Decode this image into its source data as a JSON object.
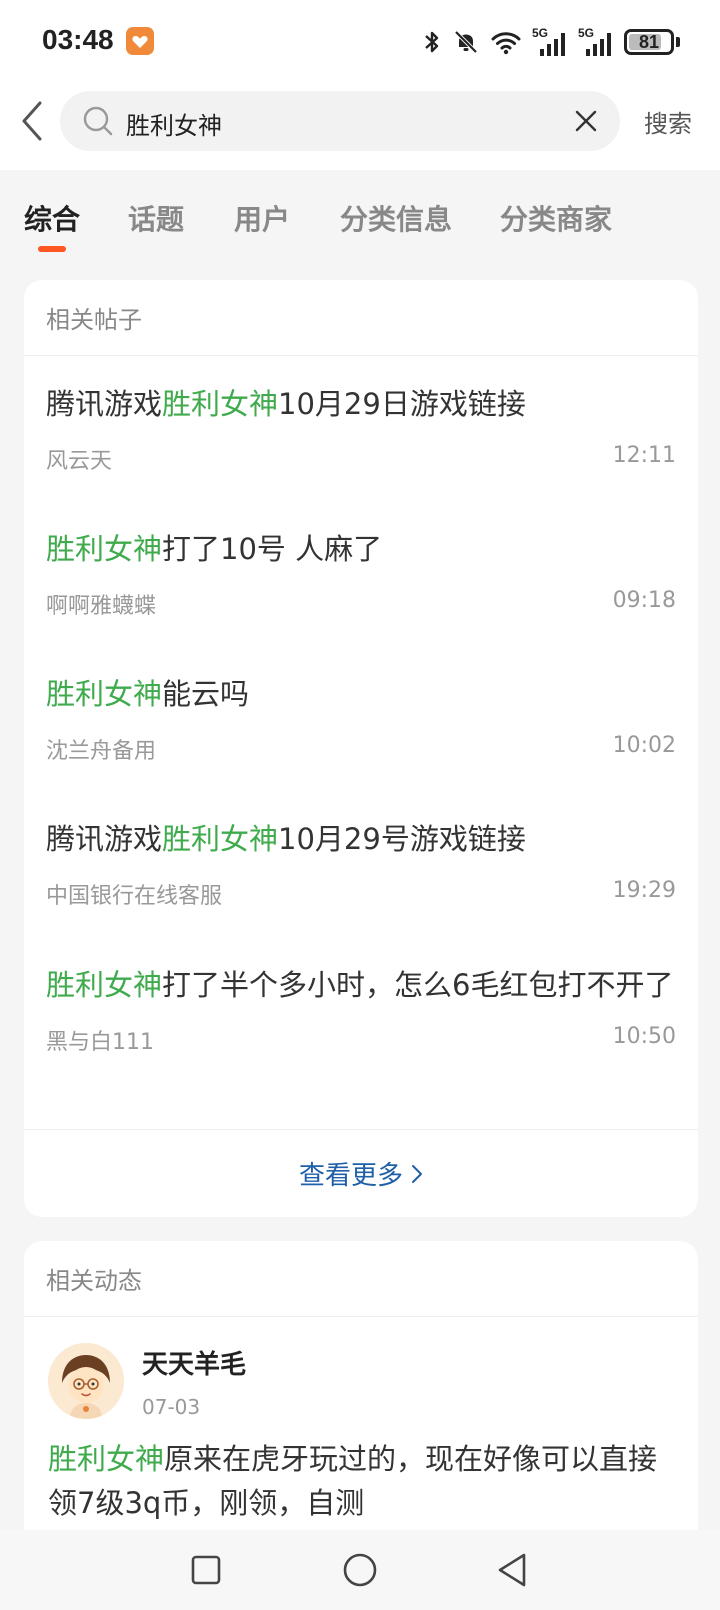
{
  "status_bar": {
    "time": "03:48",
    "network_1": "5G",
    "network_2": "5G",
    "battery": "81",
    "battery_level": 0.81
  },
  "search": {
    "query": "胜利女神",
    "search_label": "搜索"
  },
  "tabs": [
    {
      "label": "综合",
      "active": true
    },
    {
      "label": "话题",
      "active": false
    },
    {
      "label": "用户",
      "active": false
    },
    {
      "label": "分类信息",
      "active": false
    },
    {
      "label": "分类商家",
      "active": false
    }
  ],
  "related_posts": {
    "header": "相关帖子",
    "items": [
      {
        "title_before": "腾讯游戏",
        "title_highlight": "胜利女神",
        "title_after": "10月29日游戏链接",
        "author": "风云天",
        "time": "12:11"
      },
      {
        "title_before": "",
        "title_highlight": "胜利女神",
        "title_after": "打了10号 人麻了",
        "author": "啊啊雅蠛蝶",
        "time": "09:18"
      },
      {
        "title_before": "",
        "title_highlight": "胜利女神",
        "title_after": "能云吗",
        "author": "沈兰舟备用",
        "time": "10:02"
      },
      {
        "title_before": "腾讯游戏",
        "title_highlight": "胜利女神",
        "title_after": "10月29号游戏链接",
        "author": "中国银行在线客服",
        "time": "19:29"
      },
      {
        "title_before": "",
        "title_highlight": "胜利女神",
        "title_after": "打了半个多小时，怎么6毛红包打不开了",
        "author": "黑与白111",
        "time": "10:50"
      }
    ],
    "see_more": "查看更多"
  },
  "related_feeds": {
    "header": "相关动态",
    "user_name": "天天羊毛",
    "date": "07-03",
    "text_highlight": "胜利女神",
    "text_after": "原来在虎牙玩过的，现在好像可以直接领7级3q币，刚领，自测"
  },
  "colors": {
    "highlight": "#3fab4c",
    "tab_indicator": "#ff5722",
    "link": "#1f5fa8",
    "app_badge": "#f08a3a"
  },
  "icons": {
    "back": "back-arrow-icon",
    "search": "magnifier-icon",
    "clear": "close-icon",
    "see_more": "chevron-right-icon",
    "nav_recent": "square-icon",
    "nav_home": "circle-icon",
    "nav_back": "triangle-back-icon"
  }
}
